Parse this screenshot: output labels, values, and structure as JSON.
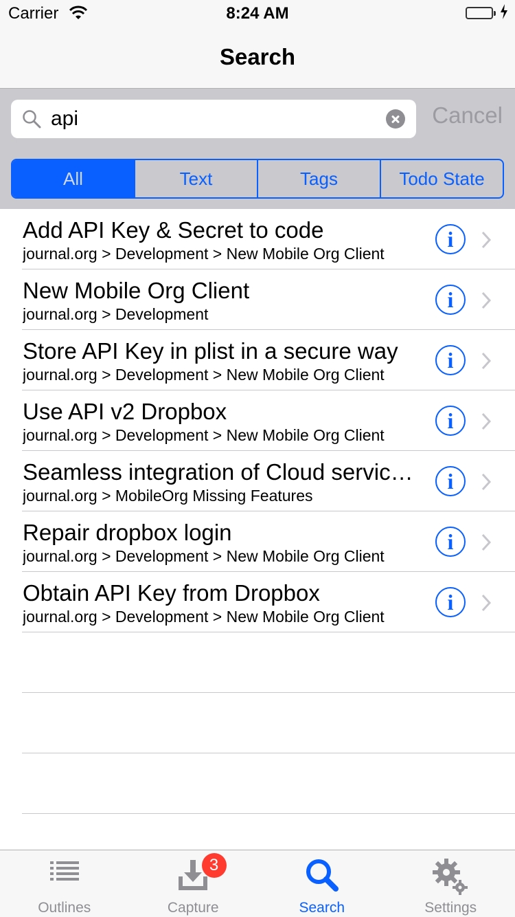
{
  "status": {
    "carrier": "Carrier",
    "time": "8:24 AM"
  },
  "nav": {
    "title": "Search"
  },
  "search": {
    "value": "api",
    "cancel_label": "Cancel"
  },
  "scopes": [
    "All",
    "Text",
    "Tags",
    "Todo State"
  ],
  "selected_scope": "All",
  "results": [
    {
      "title": "Add API Key & Secret to code",
      "path": "journal.org > Development > New Mobile Org Client"
    },
    {
      "title": "New Mobile Org Client",
      "path": "journal.org > Development"
    },
    {
      "title": "Store API Key in plist in a secure way",
      "path": "journal.org > Development > New Mobile Org Client"
    },
    {
      "title": "Use API v2 Dropbox",
      "path": "journal.org > Development > New Mobile Org Client"
    },
    {
      "title": "Seamless integration of Cloud services",
      "path": "journal.org > MobileOrg Missing Features"
    },
    {
      "title": "Repair dropbox login",
      "path": "journal.org > Development > New Mobile Org Client"
    },
    {
      "title": "Obtain API Key from Dropbox",
      "path": "journal.org > Development > New Mobile Org Client"
    }
  ],
  "tabs": [
    {
      "label": "Outlines",
      "icon": "list-icon"
    },
    {
      "label": "Capture",
      "icon": "download-tray-icon",
      "badge": "3"
    },
    {
      "label": "Search",
      "icon": "magnifier-icon"
    },
    {
      "label": "Settings",
      "icon": "gears-icon"
    }
  ],
  "active_tab": "Search",
  "colors": {
    "accent": "#0a60ff",
    "badge": "#ff3b30",
    "battery": "#4cd964",
    "search_bar_bg": "#c9c9ce"
  }
}
